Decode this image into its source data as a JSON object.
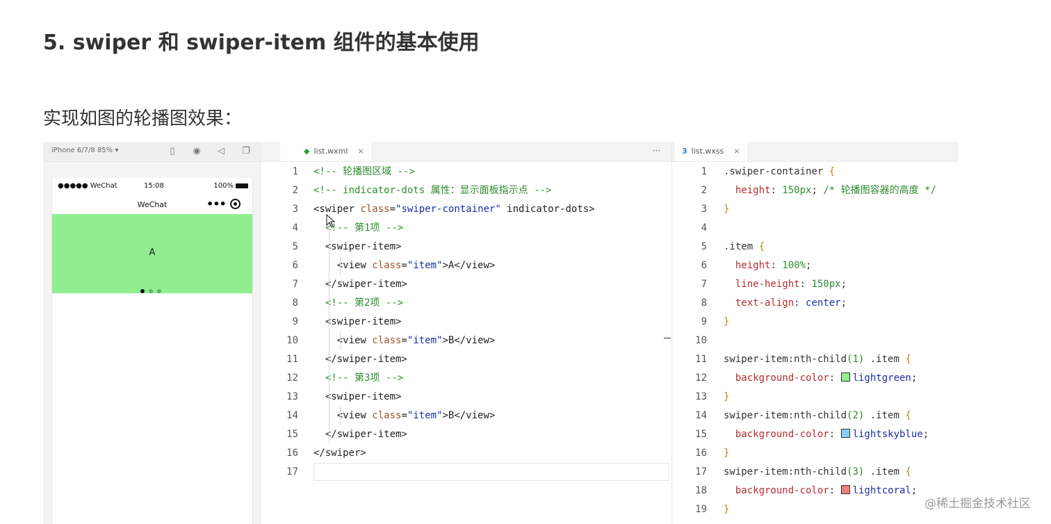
{
  "slide": {
    "title": "5. swiper 和 swiper-item 组件的基本使用",
    "subtitle": "实现如图的轮播图效果："
  },
  "simulator": {
    "device": "iPhone 6/7/8 85% ▾",
    "status": {
      "carrier": "●●●●● WeChat",
      "time": "15:08",
      "battery": "100%"
    },
    "nav_title": "WeChat",
    "nav_more": "•••",
    "swiper_text": "A",
    "dots": {
      "count": 3,
      "active": 0
    }
  },
  "editor_left": {
    "tab_label": "list.wxml",
    "tab_icon": "wxml-file-icon",
    "close": "×",
    "more": "···",
    "lines": [
      {
        "n": "1",
        "segs": [
          {
            "t": "<!-- 轮播图区域 -->",
            "c": "com"
          }
        ]
      },
      {
        "n": "2",
        "segs": [
          {
            "t": "<!-- indicator-dots 属性：显示面板指示点 -->",
            "c": "com"
          }
        ]
      },
      {
        "n": "3",
        "segs": [
          {
            "t": "<swiper ",
            "c": "tag"
          },
          {
            "t": "class",
            "c": "attr"
          },
          {
            "t": "=",
            "c": "tag"
          },
          {
            "t": "\"swiper-container\"",
            "c": "str"
          },
          {
            "t": " indicator-dots>",
            "c": "tag"
          }
        ]
      },
      {
        "n": "4",
        "segs": [
          {
            "t": "  <!-- 第1项 -->",
            "c": "com"
          }
        ]
      },
      {
        "n": "5",
        "segs": [
          {
            "t": "  <swiper-item>",
            "c": "tag"
          }
        ]
      },
      {
        "n": "6",
        "segs": [
          {
            "t": "    <view ",
            "c": "tag"
          },
          {
            "t": "class",
            "c": "attr"
          },
          {
            "t": "=",
            "c": "tag"
          },
          {
            "t": "\"item\"",
            "c": "str"
          },
          {
            "t": ">A</view>",
            "c": "tag"
          }
        ]
      },
      {
        "n": "7",
        "segs": [
          {
            "t": "  </swiper-item>",
            "c": "tag"
          }
        ]
      },
      {
        "n": "8",
        "segs": [
          {
            "t": "  <!-- 第2项 -->",
            "c": "com"
          }
        ]
      },
      {
        "n": "9",
        "segs": [
          {
            "t": "  <swiper-item>",
            "c": "tag"
          }
        ]
      },
      {
        "n": "10",
        "segs": [
          {
            "t": "    <view ",
            "c": "tag"
          },
          {
            "t": "class",
            "c": "attr"
          },
          {
            "t": "=",
            "c": "tag"
          },
          {
            "t": "\"item\"",
            "c": "str"
          },
          {
            "t": ">B</view>",
            "c": "tag"
          }
        ]
      },
      {
        "n": "11",
        "segs": [
          {
            "t": "  </swiper-item>",
            "c": "tag"
          }
        ]
      },
      {
        "n": "12",
        "segs": [
          {
            "t": "  <!-- 第3项 -->",
            "c": "com"
          }
        ]
      },
      {
        "n": "13",
        "segs": [
          {
            "t": "  <swiper-item>",
            "c": "tag"
          }
        ]
      },
      {
        "n": "14",
        "segs": [
          {
            "t": "    <view ",
            "c": "tag"
          },
          {
            "t": "class",
            "c": "attr"
          },
          {
            "t": "=",
            "c": "tag"
          },
          {
            "t": "\"item\"",
            "c": "str"
          },
          {
            "t": ">B</view>",
            "c": "tag"
          }
        ]
      },
      {
        "n": "15",
        "segs": [
          {
            "t": "  </swiper-item>",
            "c": "tag"
          }
        ]
      },
      {
        "n": "16",
        "segs": [
          {
            "t": "</swiper>",
            "c": "tag"
          }
        ]
      },
      {
        "n": "17",
        "segs": []
      }
    ]
  },
  "editor_right": {
    "tab_label": "list.wxss",
    "tab_icon": "css-file-icon",
    "close": "×",
    "lines": [
      {
        "n": "1",
        "segs": [
          {
            "t": ".swiper-container ",
            "c": "sel"
          },
          {
            "t": "{",
            "c": "brace"
          }
        ]
      },
      {
        "n": "2",
        "segs": [
          {
            "t": "  height",
            "c": "prop"
          },
          {
            "t": ": ",
            "c": "sel"
          },
          {
            "t": "150px",
            "c": "num"
          },
          {
            "t": "; ",
            "c": "sel"
          },
          {
            "t": "/* 轮播图容器的高度 */",
            "c": "com"
          }
        ]
      },
      {
        "n": "3",
        "segs": [
          {
            "t": "}",
            "c": "brace"
          }
        ]
      },
      {
        "n": "4",
        "segs": []
      },
      {
        "n": "5",
        "segs": [
          {
            "t": ".item ",
            "c": "sel"
          },
          {
            "t": "{",
            "c": "brace"
          }
        ]
      },
      {
        "n": "6",
        "segs": [
          {
            "t": "  height",
            "c": "prop"
          },
          {
            "t": ": ",
            "c": "sel"
          },
          {
            "t": "100%",
            "c": "num"
          },
          {
            "t": ";",
            "c": "sel"
          }
        ]
      },
      {
        "n": "7",
        "segs": [
          {
            "t": "  line-height",
            "c": "prop"
          },
          {
            "t": ": ",
            "c": "sel"
          },
          {
            "t": "150px",
            "c": "num"
          },
          {
            "t": ";",
            "c": "sel"
          }
        ]
      },
      {
        "n": "8",
        "segs": [
          {
            "t": "  text-align",
            "c": "prop"
          },
          {
            "t": ": ",
            "c": "sel"
          },
          {
            "t": "center",
            "c": "str"
          },
          {
            "t": ";",
            "c": "sel"
          }
        ]
      },
      {
        "n": "9",
        "segs": [
          {
            "t": "}",
            "c": "brace"
          }
        ]
      },
      {
        "n": "10",
        "segs": []
      },
      {
        "n": "11",
        "segs": [
          {
            "t": "swiper-item:nth-child",
            "c": "sel"
          },
          {
            "t": "(1)",
            "c": "num"
          },
          {
            "t": " .item ",
            "c": "sel"
          },
          {
            "t": "{",
            "c": "brace"
          }
        ]
      },
      {
        "n": "12",
        "segs": [
          {
            "t": "  background-color",
            "c": "prop"
          },
          {
            "t": ": ",
            "c": "sel"
          },
          {
            "t": "",
            "c": "swatch",
            "color": "#90ee90"
          },
          {
            "t": "lightgreen",
            "c": "str"
          },
          {
            "t": ";",
            "c": "sel"
          }
        ]
      },
      {
        "n": "13",
        "segs": [
          {
            "t": "}",
            "c": "brace"
          }
        ]
      },
      {
        "n": "14",
        "segs": [
          {
            "t": "swiper-item:nth-child",
            "c": "sel"
          },
          {
            "t": "(2)",
            "c": "num"
          },
          {
            "t": " .item ",
            "c": "sel"
          },
          {
            "t": "{",
            "c": "brace"
          }
        ]
      },
      {
        "n": "15",
        "segs": [
          {
            "t": "  background-color",
            "c": "prop"
          },
          {
            "t": ": ",
            "c": "sel"
          },
          {
            "t": "",
            "c": "swatch",
            "color": "#87cefa"
          },
          {
            "t": "lightskyblue",
            "c": "str"
          },
          {
            "t": ";",
            "c": "sel"
          }
        ]
      },
      {
        "n": "16",
        "segs": [
          {
            "t": "}",
            "c": "brace"
          }
        ]
      },
      {
        "n": "17",
        "segs": [
          {
            "t": "swiper-item:nth-child",
            "c": "sel"
          },
          {
            "t": "(3)",
            "c": "num"
          },
          {
            "t": " .item ",
            "c": "sel"
          },
          {
            "t": "{",
            "c": "brace"
          }
        ]
      },
      {
        "n": "18",
        "segs": [
          {
            "t": "  background-color",
            "c": "prop"
          },
          {
            "t": ": ",
            "c": "sel"
          },
          {
            "t": "",
            "c": "swatch",
            "color": "#f08080"
          },
          {
            "t": "lightcoral",
            "c": "str"
          },
          {
            "t": ";",
            "c": "sel"
          }
        ]
      },
      {
        "n": "19",
        "segs": [
          {
            "t": "}",
            "c": "brace"
          }
        ]
      }
    ]
  },
  "watermark": "@稀土掘金技术社区",
  "colors": {
    "swiper_bg": "#90ee90",
    "comment": "#2f8a2f",
    "property": "#b22b32",
    "string": "#1a2fa0"
  }
}
